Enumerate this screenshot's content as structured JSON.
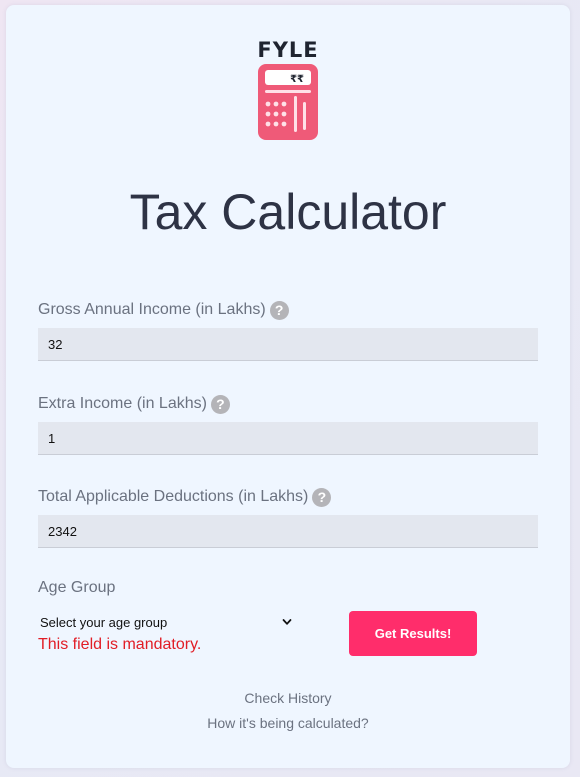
{
  "header": {
    "brand": "FYLE",
    "logo_currency_symbols": "₹₹",
    "title": "Tax Calculator"
  },
  "form": {
    "gross_income": {
      "label": "Gross Annual Income (in Lakhs)",
      "value": "32",
      "help_icon": "question-icon"
    },
    "extra_income": {
      "label": "Extra Income (in Lakhs)",
      "value": "1",
      "help_icon": "question-icon"
    },
    "deductions": {
      "label": "Total Applicable Deductions (in Lakhs)",
      "value": "2342",
      "help_icon": "question-icon"
    },
    "age_group": {
      "label": "Age Group",
      "selected": "Select your age group",
      "error": "This field is mandatory."
    },
    "submit_label": "Get Results!",
    "help_glyph": "?"
  },
  "footer": {
    "history_link": "Check History",
    "how_link": "How it's being calculated?"
  },
  "colors": {
    "accent": "#ff2d6b",
    "logo_pink": "#ef5a78",
    "error": "#e11d26",
    "card_bg": "#eff6ff"
  }
}
